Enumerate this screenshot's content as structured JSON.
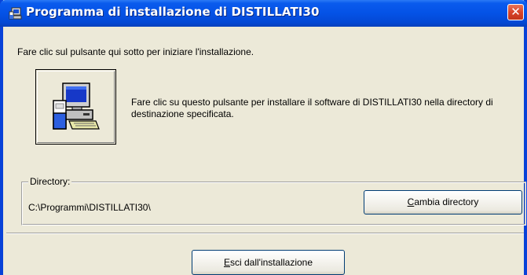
{
  "window": {
    "title": "Programma di installazione di DISTILLATI30",
    "close_glyph": "✕"
  },
  "main": {
    "instruction": "Fare clic sul pulsante qui sotto per iniziare l'installazione.",
    "install_description": "Fare clic su questo pulsante per installare il software di DISTILLATI30 nella directory di destinazione specificata.",
    "install_button_icon": "computer-setup-icon"
  },
  "directory": {
    "legend": "Directory:",
    "path": "C:\\Programmi\\DISTILLATI30\\",
    "change_button": {
      "mnemonic": "C",
      "rest": "ambia directory"
    }
  },
  "footer": {
    "exit_button": {
      "mnemonic": "E",
      "rest": "sci dall'installazione"
    }
  },
  "colors": {
    "titlebar": "#0452e6",
    "window_bg": "#ece9d8",
    "close_button": "#d8442a"
  }
}
